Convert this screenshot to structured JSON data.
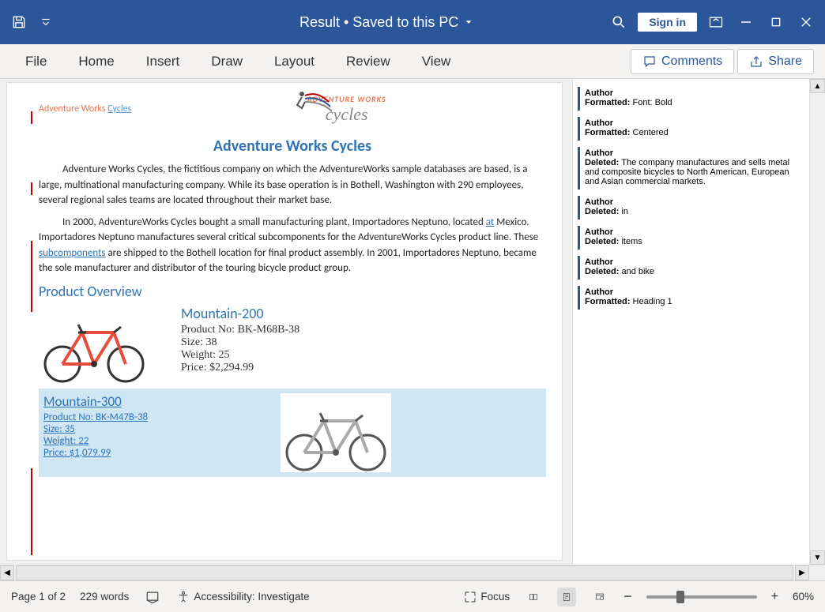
{
  "titlebar": {
    "title": "Result • Saved to this PC",
    "signin": "Sign in"
  },
  "ribbon": {
    "tabs": [
      "File",
      "Home",
      "Insert",
      "Draw",
      "Layout",
      "Review",
      "View"
    ],
    "comments": "Comments",
    "share": "Share"
  },
  "document": {
    "breadcrumb_prefix": "Adventure Works ",
    "breadcrumb_link": "Cycles",
    "logo_line1": "ADVENTURE WORKS",
    "logo_line2": "cycles",
    "title": "Adventure Works Cycles",
    "para1a": "Adventure Works Cycles, the fictitious company on which the AdventureWorks sample databases are based, is a large, multinational manufacturing company. While its base operation is in Bothell, Washington with 290 employees, several regional sales teams are located throughout their market base.",
    "para2a": "In 2000, AdventureWorks Cycles bought a small manufacturing plant, Importadores Neptuno, located ",
    "para2_link1": "at",
    "para2b": " Mexico. Importadores Neptuno manufactures several critical subcomponents for the AdventureWorks Cycles product line. These ",
    "para2_link2": "subcomponents",
    "para2c": " are shipped to the Bothell location for final product assembly. In 2001, Importadores Neptuno, became the sole manufacturer and distributor of the touring bicycle product group.",
    "heading1": "Product Overview",
    "products": [
      {
        "name": "Mountain-200",
        "product_no_label": "Product No: ",
        "product_no": "BK-M68B-38",
        "size_label": "Size: ",
        "size": "38",
        "weight_label": "Weight: ",
        "weight": "25",
        "price_label": "Price: ",
        "price": "$2,294.99"
      },
      {
        "name": "Mountain-300",
        "product_no_label": "Product No: ",
        "product_no": "BK-M47B-38",
        "size_label": "Size: ",
        "size": "35",
        "weight_label": "Weight: ",
        "weight": "22",
        "price_label": "Price: ",
        "price": "$1,079.99"
      }
    ]
  },
  "comments": [
    {
      "author": "Author",
      "kind": "Formatted:",
      "text": " Font: Bold"
    },
    {
      "author": "Author",
      "kind": "Formatted:",
      "text": " Centered"
    },
    {
      "author": "Author",
      "kind": "Deleted:",
      "text": " The company manufactures and sells metal and composite bicycles to North American, European and Asian commercial markets."
    },
    {
      "author": "Author",
      "kind": "Deleted:",
      "text": " in"
    },
    {
      "author": "Author",
      "kind": "Deleted:",
      "text": " items"
    },
    {
      "author": "Author",
      "kind": "Deleted:",
      "text": " and bike"
    },
    {
      "author": "Author",
      "kind": "Formatted:",
      "text": " Heading 1"
    }
  ],
  "statusbar": {
    "page": "Page 1 of 2",
    "words": "229 words",
    "accessibility": "Accessibility: Investigate",
    "focus": "Focus",
    "zoom_minus": "−",
    "zoom_plus": "+",
    "zoom": "60%"
  }
}
